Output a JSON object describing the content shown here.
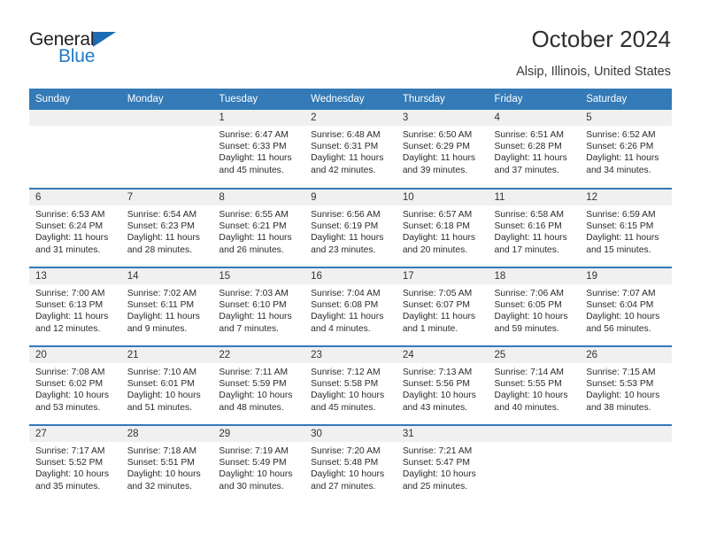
{
  "brand": {
    "name_part1": "General",
    "name_part2": "Blue",
    "accent_color": "#1f7ac4",
    "triangle_color": "#1b6cb3"
  },
  "header": {
    "title": "October 2024",
    "subtitle": "Alsip, Illinois, United States",
    "header_bg": "#337ab7",
    "daynum_bg": "#f0f0f0"
  },
  "weekdays": [
    "Sunday",
    "Monday",
    "Tuesday",
    "Wednesday",
    "Thursday",
    "Friday",
    "Saturday"
  ],
  "calendar": {
    "weeks": [
      [
        {
          "day": "",
          "empty": true
        },
        {
          "day": "",
          "empty": true
        },
        {
          "day": "1",
          "sunrise": "Sunrise: 6:47 AM",
          "sunset": "Sunset: 6:33 PM",
          "daylight_1": "Daylight: 11 hours",
          "daylight_2": "and 45 minutes."
        },
        {
          "day": "2",
          "sunrise": "Sunrise: 6:48 AM",
          "sunset": "Sunset: 6:31 PM",
          "daylight_1": "Daylight: 11 hours",
          "daylight_2": "and 42 minutes."
        },
        {
          "day": "3",
          "sunrise": "Sunrise: 6:50 AM",
          "sunset": "Sunset: 6:29 PM",
          "daylight_1": "Daylight: 11 hours",
          "daylight_2": "and 39 minutes."
        },
        {
          "day": "4",
          "sunrise": "Sunrise: 6:51 AM",
          "sunset": "Sunset: 6:28 PM",
          "daylight_1": "Daylight: 11 hours",
          "daylight_2": "and 37 minutes."
        },
        {
          "day": "5",
          "sunrise": "Sunrise: 6:52 AM",
          "sunset": "Sunset: 6:26 PM",
          "daylight_1": "Daylight: 11 hours",
          "daylight_2": "and 34 minutes."
        }
      ],
      [
        {
          "day": "6",
          "sunrise": "Sunrise: 6:53 AM",
          "sunset": "Sunset: 6:24 PM",
          "daylight_1": "Daylight: 11 hours",
          "daylight_2": "and 31 minutes."
        },
        {
          "day": "7",
          "sunrise": "Sunrise: 6:54 AM",
          "sunset": "Sunset: 6:23 PM",
          "daylight_1": "Daylight: 11 hours",
          "daylight_2": "and 28 minutes."
        },
        {
          "day": "8",
          "sunrise": "Sunrise: 6:55 AM",
          "sunset": "Sunset: 6:21 PM",
          "daylight_1": "Daylight: 11 hours",
          "daylight_2": "and 26 minutes."
        },
        {
          "day": "9",
          "sunrise": "Sunrise: 6:56 AM",
          "sunset": "Sunset: 6:19 PM",
          "daylight_1": "Daylight: 11 hours",
          "daylight_2": "and 23 minutes."
        },
        {
          "day": "10",
          "sunrise": "Sunrise: 6:57 AM",
          "sunset": "Sunset: 6:18 PM",
          "daylight_1": "Daylight: 11 hours",
          "daylight_2": "and 20 minutes."
        },
        {
          "day": "11",
          "sunrise": "Sunrise: 6:58 AM",
          "sunset": "Sunset: 6:16 PM",
          "daylight_1": "Daylight: 11 hours",
          "daylight_2": "and 17 minutes."
        },
        {
          "day": "12",
          "sunrise": "Sunrise: 6:59 AM",
          "sunset": "Sunset: 6:15 PM",
          "daylight_1": "Daylight: 11 hours",
          "daylight_2": "and 15 minutes."
        }
      ],
      [
        {
          "day": "13",
          "sunrise": "Sunrise: 7:00 AM",
          "sunset": "Sunset: 6:13 PM",
          "daylight_1": "Daylight: 11 hours",
          "daylight_2": "and 12 minutes."
        },
        {
          "day": "14",
          "sunrise": "Sunrise: 7:02 AM",
          "sunset": "Sunset: 6:11 PM",
          "daylight_1": "Daylight: 11 hours",
          "daylight_2": "and 9 minutes."
        },
        {
          "day": "15",
          "sunrise": "Sunrise: 7:03 AM",
          "sunset": "Sunset: 6:10 PM",
          "daylight_1": "Daylight: 11 hours",
          "daylight_2": "and 7 minutes."
        },
        {
          "day": "16",
          "sunrise": "Sunrise: 7:04 AM",
          "sunset": "Sunset: 6:08 PM",
          "daylight_1": "Daylight: 11 hours",
          "daylight_2": "and 4 minutes."
        },
        {
          "day": "17",
          "sunrise": "Sunrise: 7:05 AM",
          "sunset": "Sunset: 6:07 PM",
          "daylight_1": "Daylight: 11 hours",
          "daylight_2": "and 1 minute."
        },
        {
          "day": "18",
          "sunrise": "Sunrise: 7:06 AM",
          "sunset": "Sunset: 6:05 PM",
          "daylight_1": "Daylight: 10 hours",
          "daylight_2": "and 59 minutes."
        },
        {
          "day": "19",
          "sunrise": "Sunrise: 7:07 AM",
          "sunset": "Sunset: 6:04 PM",
          "daylight_1": "Daylight: 10 hours",
          "daylight_2": "and 56 minutes."
        }
      ],
      [
        {
          "day": "20",
          "sunrise": "Sunrise: 7:08 AM",
          "sunset": "Sunset: 6:02 PM",
          "daylight_1": "Daylight: 10 hours",
          "daylight_2": "and 53 minutes."
        },
        {
          "day": "21",
          "sunrise": "Sunrise: 7:10 AM",
          "sunset": "Sunset: 6:01 PM",
          "daylight_1": "Daylight: 10 hours",
          "daylight_2": "and 51 minutes."
        },
        {
          "day": "22",
          "sunrise": "Sunrise: 7:11 AM",
          "sunset": "Sunset: 5:59 PM",
          "daylight_1": "Daylight: 10 hours",
          "daylight_2": "and 48 minutes."
        },
        {
          "day": "23",
          "sunrise": "Sunrise: 7:12 AM",
          "sunset": "Sunset: 5:58 PM",
          "daylight_1": "Daylight: 10 hours",
          "daylight_2": "and 45 minutes."
        },
        {
          "day": "24",
          "sunrise": "Sunrise: 7:13 AM",
          "sunset": "Sunset: 5:56 PM",
          "daylight_1": "Daylight: 10 hours",
          "daylight_2": "and 43 minutes."
        },
        {
          "day": "25",
          "sunrise": "Sunrise: 7:14 AM",
          "sunset": "Sunset: 5:55 PM",
          "daylight_1": "Daylight: 10 hours",
          "daylight_2": "and 40 minutes."
        },
        {
          "day": "26",
          "sunrise": "Sunrise: 7:15 AM",
          "sunset": "Sunset: 5:53 PM",
          "daylight_1": "Daylight: 10 hours",
          "daylight_2": "and 38 minutes."
        }
      ],
      [
        {
          "day": "27",
          "sunrise": "Sunrise: 7:17 AM",
          "sunset": "Sunset: 5:52 PM",
          "daylight_1": "Daylight: 10 hours",
          "daylight_2": "and 35 minutes."
        },
        {
          "day": "28",
          "sunrise": "Sunrise: 7:18 AM",
          "sunset": "Sunset: 5:51 PM",
          "daylight_1": "Daylight: 10 hours",
          "daylight_2": "and 32 minutes."
        },
        {
          "day": "29",
          "sunrise": "Sunrise: 7:19 AM",
          "sunset": "Sunset: 5:49 PM",
          "daylight_1": "Daylight: 10 hours",
          "daylight_2": "and 30 minutes."
        },
        {
          "day": "30",
          "sunrise": "Sunrise: 7:20 AM",
          "sunset": "Sunset: 5:48 PM",
          "daylight_1": "Daylight: 10 hours",
          "daylight_2": "and 27 minutes."
        },
        {
          "day": "31",
          "sunrise": "Sunrise: 7:21 AM",
          "sunset": "Sunset: 5:47 PM",
          "daylight_1": "Daylight: 10 hours",
          "daylight_2": "and 25 minutes."
        },
        {
          "day": "",
          "empty": true
        },
        {
          "day": "",
          "empty": true
        }
      ]
    ]
  }
}
